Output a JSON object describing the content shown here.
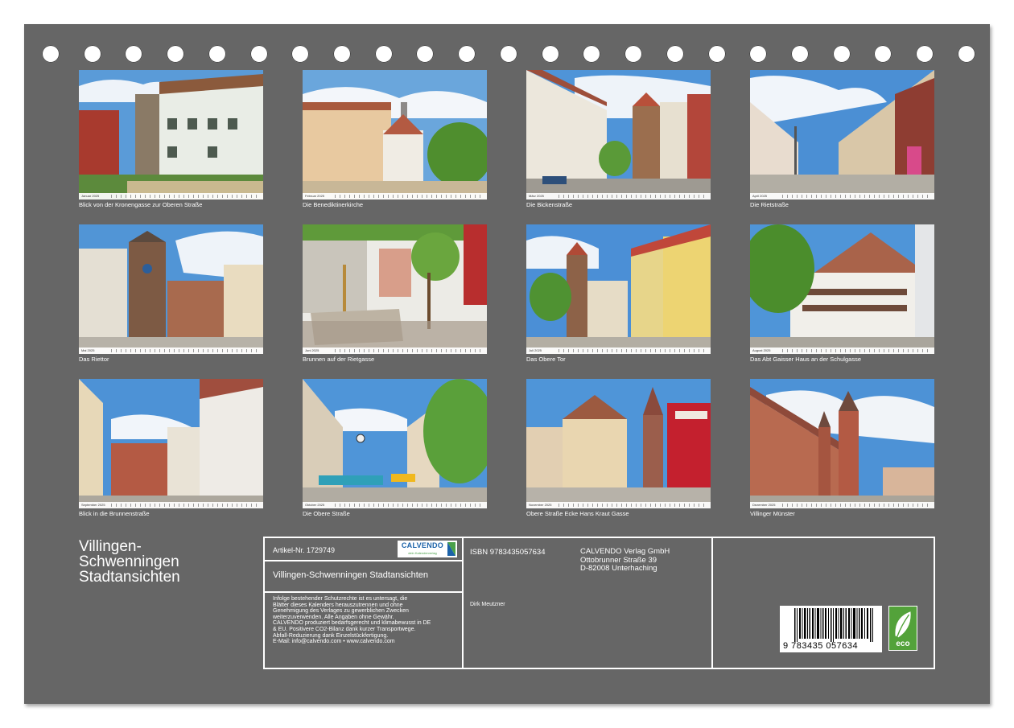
{
  "photos": [
    {
      "month": "Januar 2025",
      "caption": "Blick von der Kronengasse zur Oberen Straße"
    },
    {
      "month": "Februar 2025",
      "caption": "Die Benediktinerkirche"
    },
    {
      "month": "März 2025",
      "caption": "Die Bickenstraße"
    },
    {
      "month": "April 2025",
      "caption": "Die Rietstraße"
    },
    {
      "month": "Mai 2025",
      "caption": "Das Riettor"
    },
    {
      "month": "Juni 2025",
      "caption": "Brunnen auf der Rietgasse"
    },
    {
      "month": "Juli 2025",
      "caption": "Das Obere Tor"
    },
    {
      "month": "August 2025",
      "caption": "Das Abt Gaisser Haus an der Schulgasse"
    },
    {
      "month": "September 2025",
      "caption": "Blick in die Brunnenstraße"
    },
    {
      "month": "Oktober 2025",
      "caption": "Die Obere Straße"
    },
    {
      "month": "November 2025",
      "caption": "Obere Straße Ecke Hans Kraut Gasse"
    },
    {
      "month": "Dezember 2025",
      "caption": "Villinger Münster"
    }
  ],
  "title": {
    "line1": "Villingen-",
    "line2": "Schwenningen",
    "line3": "Stadtansichten"
  },
  "info": {
    "article": "Artikel-Nr. 1729749",
    "logo_name": "CALVENDO",
    "logo_tagline": "dein Kalenderverlag",
    "product_title": "Villingen-Schwenningen Stadtansichten",
    "legal": [
      "Infolge bestehender Schutzrechte ist es untersagt, die",
      "Blätter dieses Kalenders herauszutrennen und ohne",
      "Genehmigung des Verlages zu gewerblichen Zwecken",
      "weiterzuverwenden. Alle Angaben ohne Gewähr.",
      "CALVENDO produziert bedarfsgerecht und klimabewusst in DE",
      "& EU. Positivere CO2-Bilanz dank kurzer Transportwege.",
      "Abfall-Reduzierung dank Einzelstückfertigung.",
      "E-Mail: info@calvendo.com • www.calvendo.com"
    ],
    "isbn": "ISBN 9783435057634",
    "author": "Dirk Meutzner",
    "publisher": [
      "CALVENDO Verlag GmbH",
      "Ottobrunner Straße 39",
      "D-82008 Unterhaching"
    ],
    "barcode_number": "9 783435 057634",
    "eco_label": "eco"
  },
  "colors": {
    "background": "#666666",
    "text": "#ffffff",
    "eco_green": "#53a23a",
    "calvendo_blue": "#1b62a8"
  }
}
